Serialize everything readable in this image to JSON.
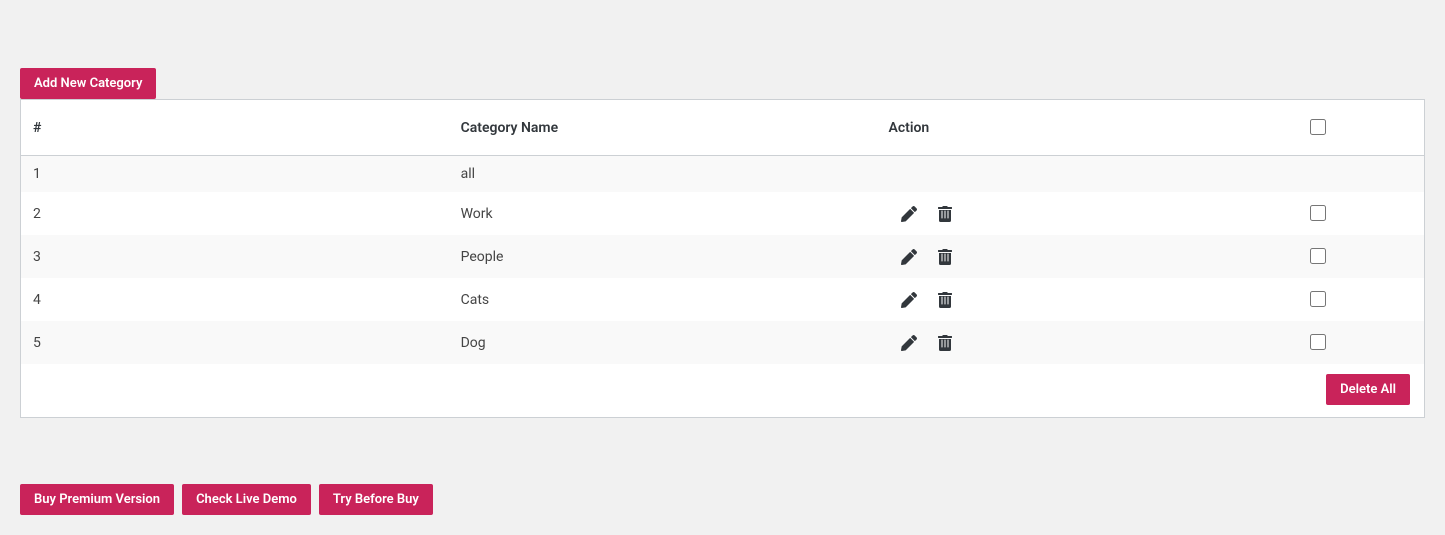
{
  "accent": "#c9235a",
  "buttons": {
    "add_new": "Add New Category",
    "delete_all": "Delete All",
    "buy_premium": "Buy Premium Version",
    "check_demo": "Check Live Demo",
    "try_before_buy": "Try Before Buy"
  },
  "table": {
    "headers": {
      "number": "#",
      "name": "Category Name",
      "action": "Action"
    },
    "rows": [
      {
        "num": "1",
        "name": "all",
        "editable": false,
        "checkbox": false
      },
      {
        "num": "2",
        "name": "Work",
        "editable": true,
        "checkbox": true
      },
      {
        "num": "3",
        "name": "People",
        "editable": true,
        "checkbox": true
      },
      {
        "num": "4",
        "name": "Cats",
        "editable": true,
        "checkbox": true
      },
      {
        "num": "5",
        "name": "Dog",
        "editable": true,
        "checkbox": true
      }
    ]
  }
}
